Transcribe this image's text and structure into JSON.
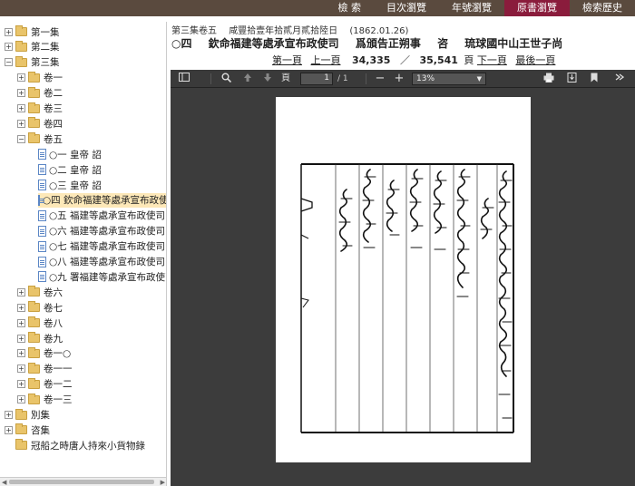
{
  "nav": [
    "檢 索",
    "目次瀏覽",
    "年號瀏覽",
    "原書瀏覽",
    "檢索歷史"
  ],
  "nav_active_index": 3,
  "tree": {
    "top": [
      {
        "label": "第一集",
        "toggle": "+"
      },
      {
        "label": "第二集",
        "toggle": "+"
      },
      {
        "label": "第三集",
        "toggle": "−"
      }
    ],
    "vols_a": [
      "卷一",
      "卷二",
      "卷三",
      "卷四"
    ],
    "vol5": "卷五",
    "docs": [
      "○一 皇帝 詔",
      "○二 皇帝 詔",
      "○三 皇帝 詔",
      "○四 欽命福建等處承宣布政使",
      "○五 福建等處承宣布政使司",
      "○六 福建等處承宣布政使司",
      "○七 福建等處承宣布政使司",
      "○八 福建等處承宣布政使司",
      "○九 署福建等處承宣布政使司"
    ],
    "selected_doc": 3,
    "vols_b": [
      "卷六",
      "卷七",
      "卷八",
      "卷九",
      "卷一○",
      "卷一一",
      "卷一二",
      "卷一三"
    ],
    "bottom": [
      {
        "label": "別集",
        "toggle": "+"
      },
      {
        "label": "咨集",
        "toggle": "+"
      },
      {
        "label": "冠船之時唐人持來小貨物錄",
        "toggle": ""
      }
    ]
  },
  "header": {
    "line1": [
      "第三集卷五",
      "咸豐拾壹年拾貳月貳拾陸日",
      "(1862.01.26)"
    ],
    "line2": [
      "○四",
      "欽命福建等處承宣布政使司",
      "爲頒告正朔事",
      "咨",
      "琉球國中山王世子尚"
    ]
  },
  "pager": {
    "first": "第一頁",
    "prev": "上一頁",
    "current": "34,335",
    "slash": "／",
    "total": "35,541",
    "unit": "頁",
    "next": "下一頁",
    "last": "最後一頁"
  },
  "viewer": {
    "page_value": "1",
    "page_total": "/ 1",
    "page_label": "頁",
    "zoom": "13%"
  }
}
